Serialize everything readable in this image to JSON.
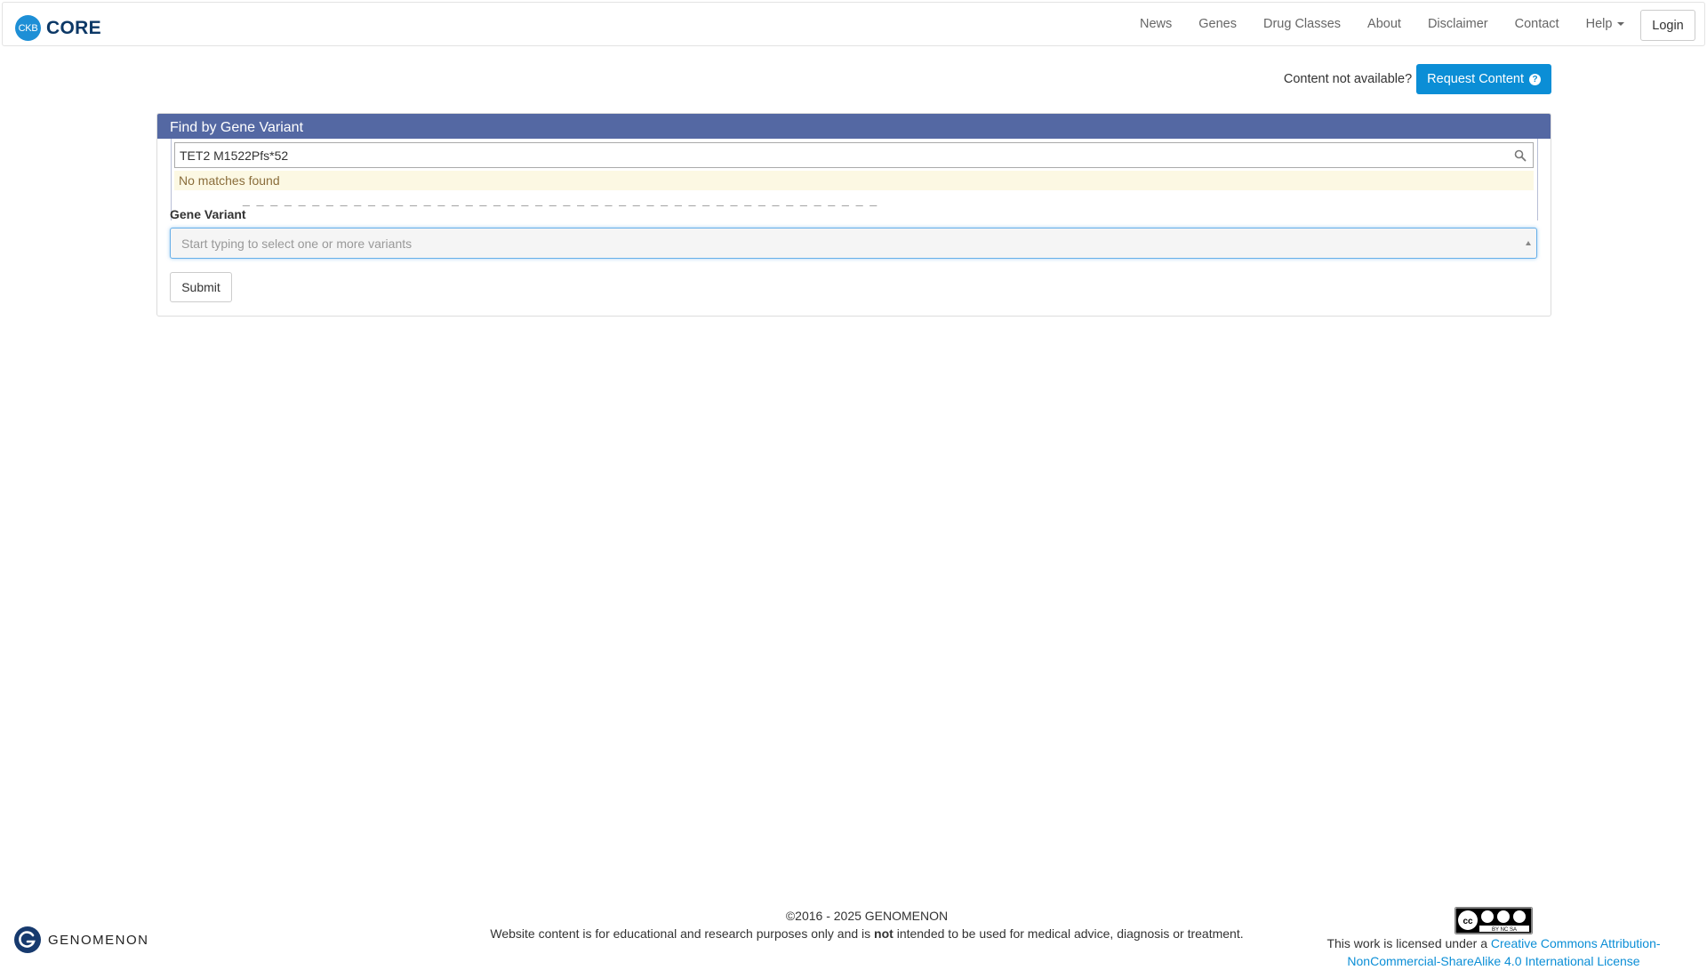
{
  "brand": {
    "badge": "CKB",
    "name": "CORE"
  },
  "nav": {
    "items": [
      "News",
      "Genes",
      "Drug Classes",
      "About",
      "Disclaimer",
      "Contact"
    ],
    "help_label": "Help",
    "login_label": "Login"
  },
  "request": {
    "text": "Content not available?",
    "button_label": "Request Content"
  },
  "panel": {
    "title": "Find by Gene Variant",
    "search_value": "TET2 M1522Pfs*52",
    "no_matches": "No matches found",
    "field_label": "Gene Variant",
    "variant_placeholder": "Start typing to select one or more variants",
    "submit_label": "Submit"
  },
  "footer": {
    "logo_text": "GENOMENON",
    "copyright": "©2016 - 2025 GENOMENON",
    "disclaimer_pre": "Website content is for educational and research purposes only and is ",
    "disclaimer_bold": "not",
    "disclaimer_post": " intended to be used for medical advice, diagnosis or treatment.",
    "license_pre": "This work is licensed under a ",
    "license_link": "Creative Commons Attribution-NonCommercial-ShareAlike 4.0 International License",
    "cc_badge_text": "BY NC SA"
  },
  "colors": {
    "brand_blue": "#1d8fd6",
    "panel_heading": "#5468a3",
    "request_button": "#0b8ed6",
    "no_match_bg": "#fcf8e3"
  }
}
